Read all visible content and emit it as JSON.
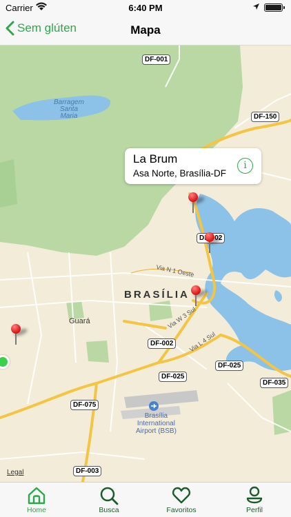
{
  "status_bar": {
    "carrier": "Carrier",
    "time": "6:40 PM"
  },
  "nav": {
    "back_label": "Sem glúten",
    "title": "Mapa"
  },
  "callout": {
    "name": "La Brum",
    "address": "Asa Norte, Brasília-DF",
    "info_glyph": "i"
  },
  "map": {
    "city_label": "BRASÍLIA",
    "labels": {
      "lake": "Barragem\nSanta\nMaria",
      "guara": "Guará",
      "airport": "Brasília\nInternational\nAirport (BSB)",
      "road_n1": "Via N 1 Oeste",
      "road_w3": "Via W 3 Sul",
      "road_l4": "Via L 4 Sul",
      "legal": "Legal"
    },
    "shields": [
      "DF-001",
      "DF-150",
      "DF-002",
      "DF-002",
      "DF-025",
      "DF-025",
      "DF-035",
      "DF-075",
      "DF-003"
    ]
  },
  "tabs": [
    {
      "label": "Home",
      "icon": "home-icon",
      "active": true
    },
    {
      "label": "Busca",
      "icon": "search-icon",
      "active": false
    },
    {
      "label": "Favoritos",
      "icon": "heart-icon",
      "active": false
    },
    {
      "label": "Perfil",
      "icon": "profile-icon",
      "active": false
    }
  ],
  "colors": {
    "accent": "#2ca84a",
    "tab_inactive": "#1c5c2c",
    "park_green": "#b9d8a4",
    "water": "#8cc2e8",
    "highway": "#f4c443"
  }
}
